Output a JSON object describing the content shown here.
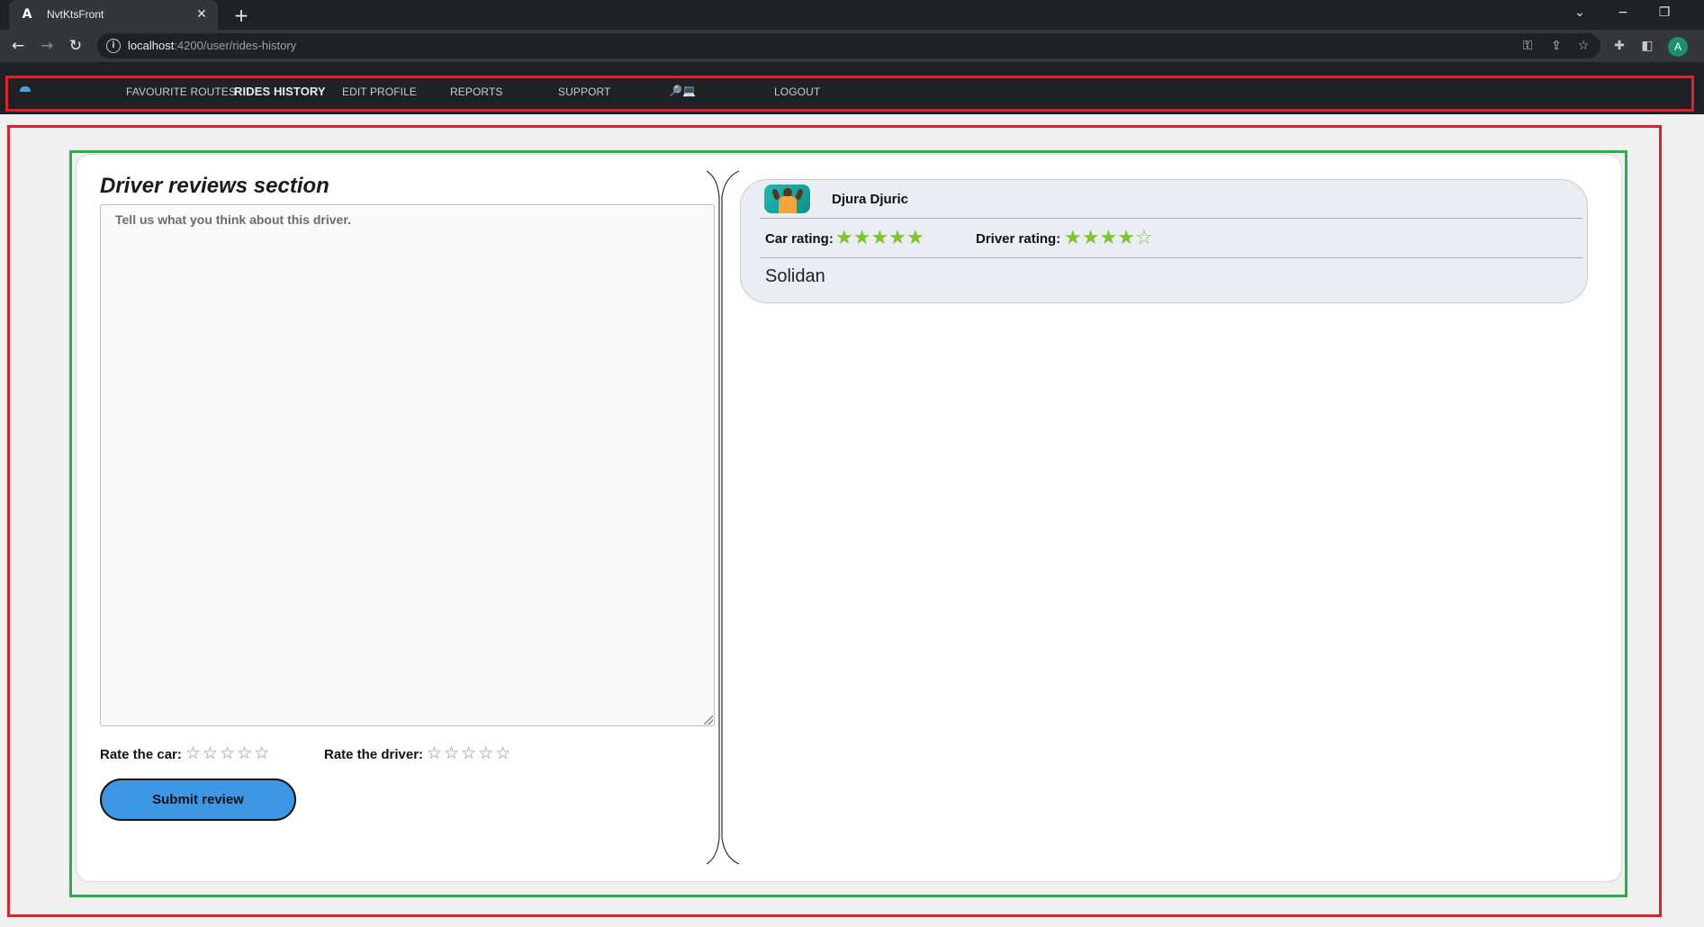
{
  "browser": {
    "tab_title": "NvtKtsFront",
    "url_host": "localhost",
    "url_path": ":4200/user/rides-history",
    "profile_initial": "A"
  },
  "nav": {
    "items": [
      {
        "label": "FAVOURITE ROUTES",
        "active": false
      },
      {
        "label": "RIDES HISTORY",
        "active": true
      },
      {
        "label": "EDIT PROFILE",
        "active": false
      },
      {
        "label": "REPORTS",
        "active": false
      },
      {
        "label": "SUPPORT",
        "active": false
      },
      {
        "label": "LOGOUT",
        "active": false
      }
    ],
    "icons": "🔎💻"
  },
  "review_form": {
    "title": "Driver reviews section",
    "placeholder": "Tell us what you think about this driver.",
    "rate_car_label": "Rate the car:",
    "rate_driver_label": "Rate the driver:",
    "car_rating_selected": 0,
    "driver_rating_selected": 0,
    "max_stars": 5,
    "submit_label": "Submit review"
  },
  "reviews": [
    {
      "driver_name": "Djura Djuric",
      "car_rating_label": "Car rating:",
      "car_rating": 5,
      "driver_rating_label": "Driver rating:",
      "driver_rating": 4,
      "comment": "Solidan"
    }
  ],
  "colors": {
    "highlight_red": "#e0202a",
    "highlight_green": "#22b14c",
    "submit_button": "#3d97e4",
    "rating_star": "#7cc52a"
  }
}
